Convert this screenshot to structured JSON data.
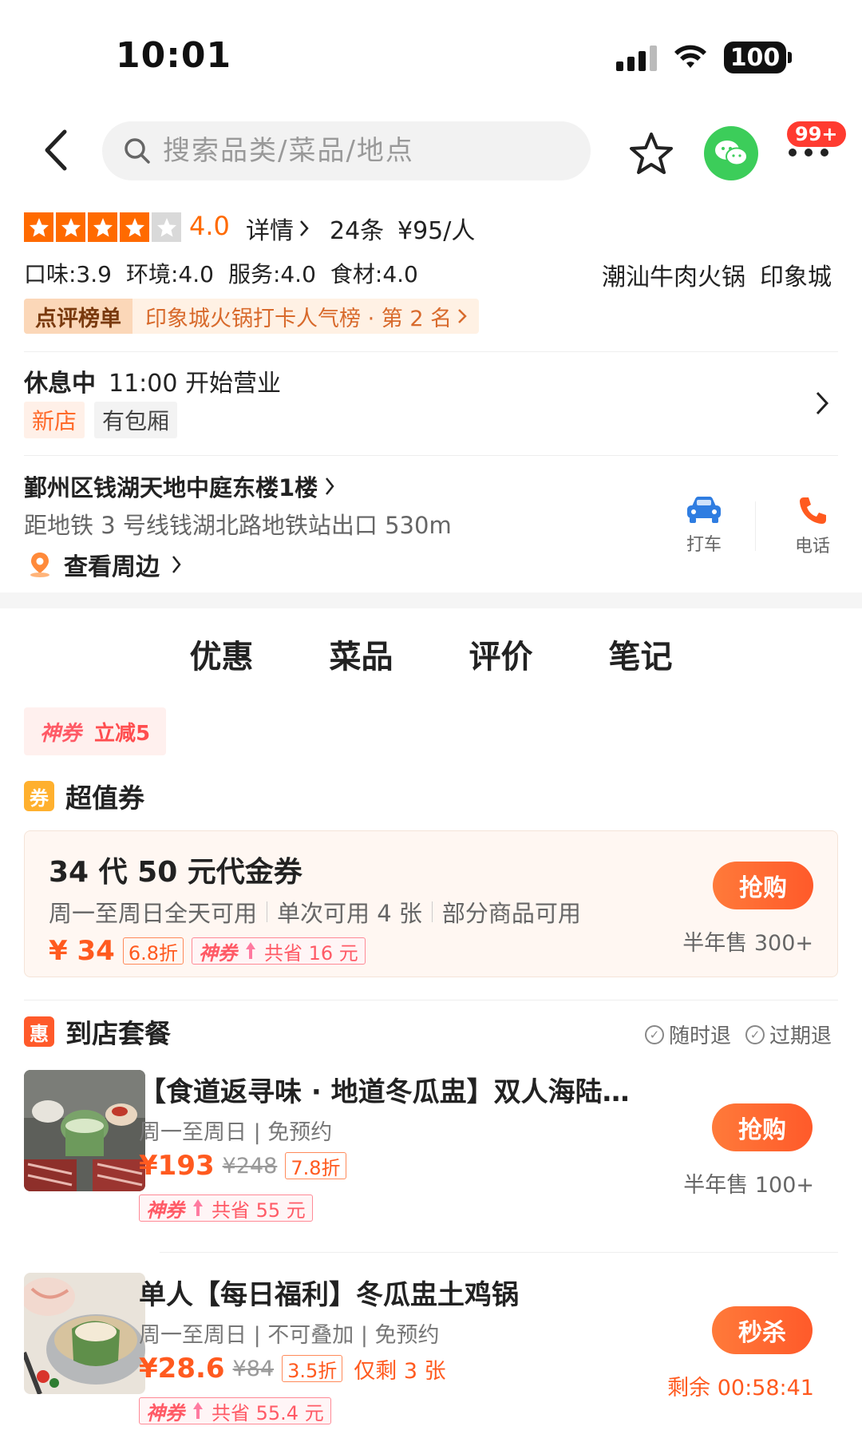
{
  "status_bar": {
    "time": "10:01",
    "battery": "100"
  },
  "header": {
    "search_placeholder": "搜索品类/菜品/地点",
    "more_badge": "99+"
  },
  "rating": {
    "stars": 4,
    "score": "4.0",
    "detail_link": "详情",
    "review_count": "24条",
    "price_per_person": "¥95/人",
    "sub_scores": [
      "口味:3.9",
      "环境:4.0",
      "服务:4.0",
      "食材:4.0"
    ],
    "category": "潮汕牛肉火锅",
    "area": "印象城"
  },
  "ranking": {
    "badge": "点评榜单",
    "text": "印象城火锅打卡人气榜 · 第 2 名"
  },
  "business": {
    "status": "休息中",
    "hours": "11:00 开始营业",
    "tags": [
      "新店",
      "有包厢"
    ]
  },
  "address": {
    "line": "鄞州区钱湖天地中庭东楼1楼",
    "distance": "距地铁 3 号线钱湖北路地铁站出口 530m",
    "nearby": "查看周边",
    "taxi_label": "打车",
    "phone_label": "电话"
  },
  "tabs": [
    {
      "label": "优惠",
      "active": true
    },
    {
      "label": "菜品",
      "active": false
    },
    {
      "label": "评价",
      "active": false
    },
    {
      "label": "笔记",
      "active": false
    }
  ],
  "coupon_chip": {
    "brand": "神券",
    "text": "立减5"
  },
  "vouchers_section": {
    "icon": "券",
    "title": "超值券",
    "item": {
      "title": "34 代 50 元代金券",
      "rules": [
        "周一至周日全天可用",
        "单次可用 4 张",
        "部分商品可用"
      ],
      "price": "¥ 34",
      "discount": "6.8折",
      "shen": "神券",
      "save": "共省 16 元",
      "button": "抢购",
      "sold": "半年售 300+"
    }
  },
  "packages_section": {
    "icon": "惠",
    "title": "到店套餐",
    "refund_badges": [
      "随时退",
      "过期退"
    ],
    "items": [
      {
        "title": "【食道返寻味 · 地道冬瓜盅】双人海陆…",
        "meta": "周一至周日 | 免预约",
        "price": "¥193",
        "old_price": "¥248",
        "discount": "7.8折",
        "extra": "",
        "shen": "神券",
        "save": "共省 55 元",
        "button": "抢购",
        "sold": "半年售 100+"
      },
      {
        "title": "单人【每日福利】冬瓜盅土鸡锅",
        "meta": "周一至周日 | 不可叠加 | 免预约",
        "price": "¥28.6",
        "old_price": "¥84",
        "discount": "3.5折",
        "extra": "仅剩 3 张",
        "shen": "神券",
        "save": "共省 55.4 元",
        "button": "秒杀",
        "sold": "剩余 00:58:41"
      }
    ]
  },
  "colors": {
    "accent": "#ff6a00",
    "buy_button": "#ff5a2a",
    "shen_pink": "#ff5a66",
    "wechat_green": "#3ccd5a"
  }
}
